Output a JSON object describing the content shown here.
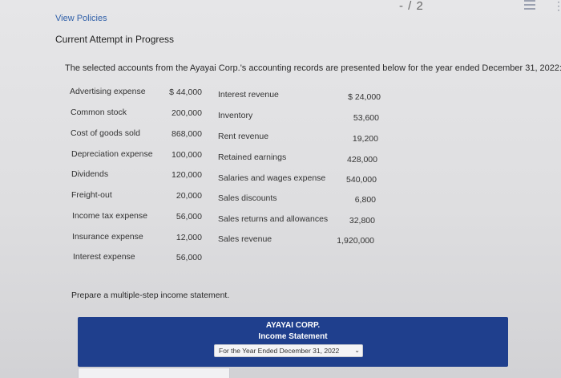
{
  "header": {
    "page_indicator": "- / 2",
    "view_policies": "View Policies",
    "attempt": "Current Attempt in Progress"
  },
  "question": {
    "intro": "The selected accounts from the Ayayai Corp.'s accounting records are presented below for the year ended December 31, 2022:",
    "prepare": "Prepare a multiple-step income statement."
  },
  "accounts_left": [
    {
      "name": "Advertising expense",
      "value": "$ 44,000"
    },
    {
      "name": "Common stock",
      "value": "200,000"
    },
    {
      "name": "Cost of goods sold",
      "value": "868,000"
    },
    {
      "name": "Depreciation expense",
      "value": "100,000"
    },
    {
      "name": "Dividends",
      "value": "120,000"
    },
    {
      "name": "Freight-out",
      "value": "20,000"
    },
    {
      "name": "Income tax expense",
      "value": "56,000"
    },
    {
      "name": "Insurance expense",
      "value": "12,000"
    },
    {
      "name": "Interest expense",
      "value": "56,000"
    }
  ],
  "accounts_right": [
    {
      "name": "Interest revenue",
      "value": "$ 24,000"
    },
    {
      "name": "Inventory",
      "value": "53,600"
    },
    {
      "name": "Rent revenue",
      "value": "19,200"
    },
    {
      "name": "Retained earnings",
      "value": "428,000"
    },
    {
      "name": "Salaries and wages expense",
      "value": "540,000"
    },
    {
      "name": "Sales discounts",
      "value": "6,800"
    },
    {
      "name": "Sales returns and allowances",
      "value": "32,800"
    },
    {
      "name": "Sales revenue",
      "value": "1,920,000"
    }
  ],
  "statement": {
    "company": "AYAYAI CORP.",
    "title": "Income Statement",
    "period_selected": "For the Year Ended December 31, 2022"
  },
  "colors": {
    "header_band": "#1f3f8d",
    "link": "#2f5fa8"
  },
  "icons": [
    "list-icon",
    "more-icon",
    "chevron-down-icon"
  ]
}
